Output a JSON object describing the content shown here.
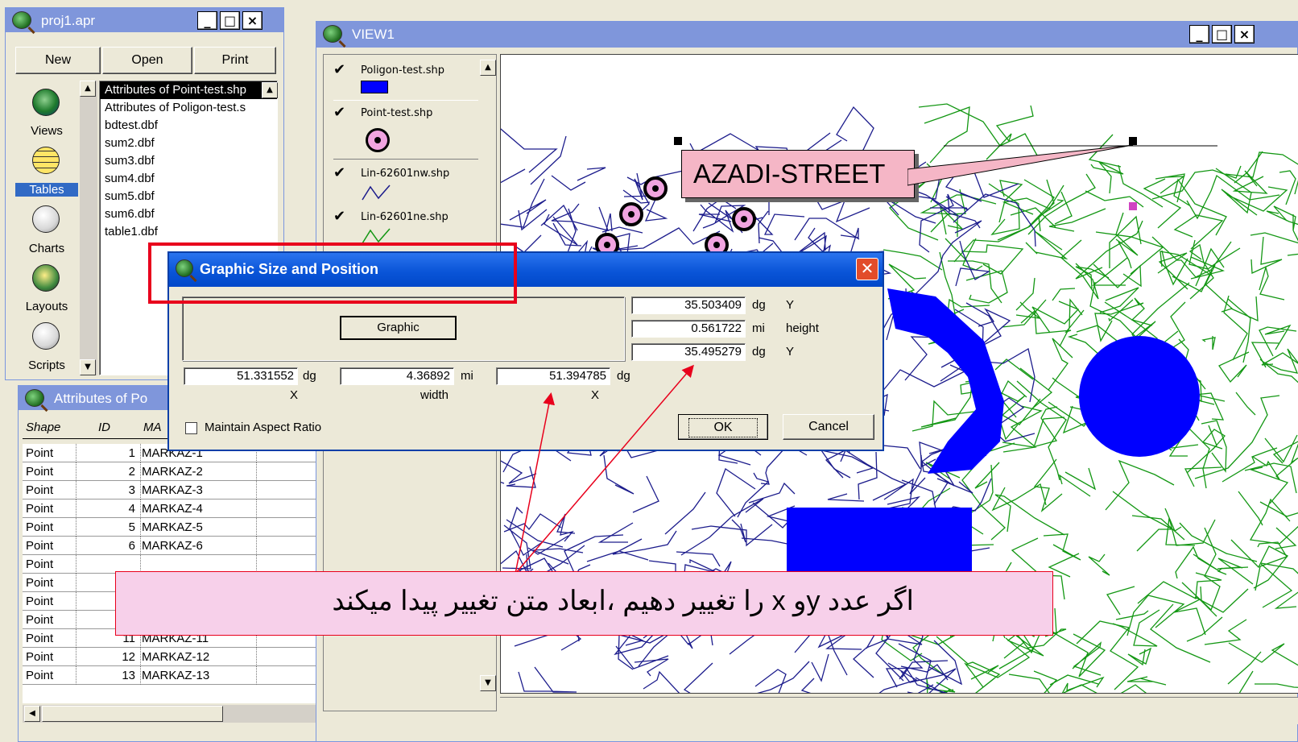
{
  "project_window": {
    "title": "proj1.apr",
    "buttons": [
      "New",
      "Open",
      "Print"
    ],
    "categories": [
      "Views",
      "Tables",
      "Charts",
      "Layouts",
      "Scripts"
    ],
    "selected_category": "Tables",
    "documents": [
      "Attributes of Point-test.shp",
      "Attributes of Poligon-test.s",
      "bdtest.dbf",
      "sum2.dbf",
      "sum3.dbf",
      "sum4.dbf",
      "sum5.dbf",
      "sum6.dbf",
      "table1.dbf"
    ]
  },
  "view_window": {
    "title": "VIEW1",
    "layers": [
      {
        "name": "Poligon-test.shp",
        "checked": true
      },
      {
        "name": "Point-test.shp",
        "checked": true
      },
      {
        "name": "Lin-62601nw.shp",
        "checked": true
      },
      {
        "name": "Lin-62601ne.shp",
        "checked": true
      }
    ],
    "label_text": "AZADI-STREET"
  },
  "table_window": {
    "title": "Attributes of Po",
    "columns": [
      "Shape",
      "ID",
      "MA"
    ],
    "rows": [
      [
        "Point",
        "1",
        "MARKAZ-1"
      ],
      [
        "Point",
        "2",
        "MARKAZ-2"
      ],
      [
        "Point",
        "3",
        "MARKAZ-3"
      ],
      [
        "Point",
        "4",
        "MARKAZ-4"
      ],
      [
        "Point",
        "5",
        "MARKAZ-5"
      ],
      [
        "Point",
        "6",
        "MARKAZ-6"
      ],
      [
        "Point",
        "",
        ""
      ],
      [
        "Point",
        "",
        ""
      ],
      [
        "Point",
        "",
        ""
      ],
      [
        "Point",
        "10",
        "MARKAZ-10"
      ],
      [
        "Point",
        "11",
        "MARKAZ-11"
      ],
      [
        "Point",
        "12",
        "MARKAZ-12"
      ],
      [
        "Point",
        "13",
        "MARKAZ-13"
      ]
    ]
  },
  "dialog": {
    "title": "Graphic Size and Position",
    "graphic_button": "Graphic",
    "top_y": {
      "value": "35.503409",
      "unit": "dg",
      "label": "Y"
    },
    "height": {
      "value": "0.561722",
      "unit": "mi",
      "label": "height"
    },
    "bottom_y": {
      "value": "35.495279",
      "unit": "dg",
      "label": "Y"
    },
    "left_x": {
      "value": "51.331552",
      "unit": "dg",
      "label": "X"
    },
    "width": {
      "value": "4.36892",
      "unit": "mi",
      "label": "width"
    },
    "right_x": {
      "value": "51.394785",
      "unit": "dg",
      "label": "X"
    },
    "maintain_aspect_label": "Maintain Aspect Ratio",
    "maintain_aspect_checked": false,
    "ok_label": "OK",
    "cancel_label": "Cancel"
  },
  "annotation": {
    "text": "اگر عدد  yو x را تغییر دهیم ،ابعاد متن تغییر پیدا میکند"
  },
  "colors": {
    "titlebar": "#7f96db",
    "dialog_titlebar": "#0a55d8",
    "highlight_box": "#e8001c",
    "callout_fill": "#f5b6c6",
    "annotation_fill": "#f7d0ea",
    "polygon_blue": "#0000ff",
    "roads_navy": "#1c1c8c",
    "roads_green": "#139713"
  }
}
